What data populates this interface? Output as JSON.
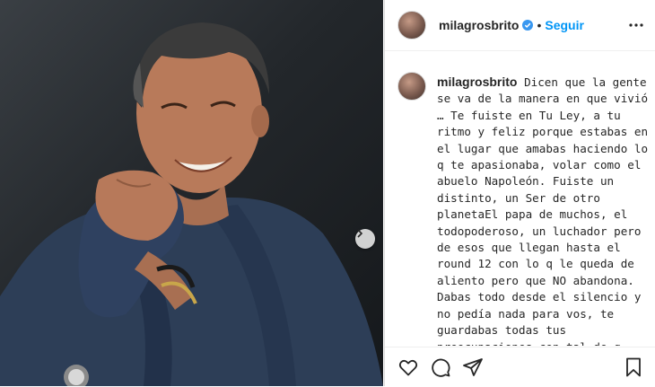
{
  "post": {
    "username": "milagrosbrito",
    "separator": "•",
    "follow_label": "Seguir",
    "caption_text": "Dicen que la gente se va de la manera en que vivió … Te fuiste en Tu Ley, a tu ritmo y feliz porque estabas en el lugar que amabas haciendo lo q te apasionaba, volar como el abuelo Napoleón. Fuiste un distinto, un Ser de otro planetaEl papa de muchos, el todopoderoso, un luchador pero de esos que llegan hasta el round 12 con lo q le queda de aliento pero que NO abandona. Dabas todo desde el silencio y no pedía nada para vos, te guardabas todas tus preocupaciones con tal de q mami y nosotros estuviéramos"
  },
  "icons": {
    "verified": "verified-badge-icon",
    "more": "more-options-icon",
    "carousel": "chevron-right-icon",
    "like": "heart-icon",
    "comment": "comment-icon",
    "share": "paper-plane-icon",
    "save": "bookmark-icon"
  },
  "colors": {
    "accent": "#0095f6",
    "text": "#262626",
    "border": "#dbdbdb"
  }
}
